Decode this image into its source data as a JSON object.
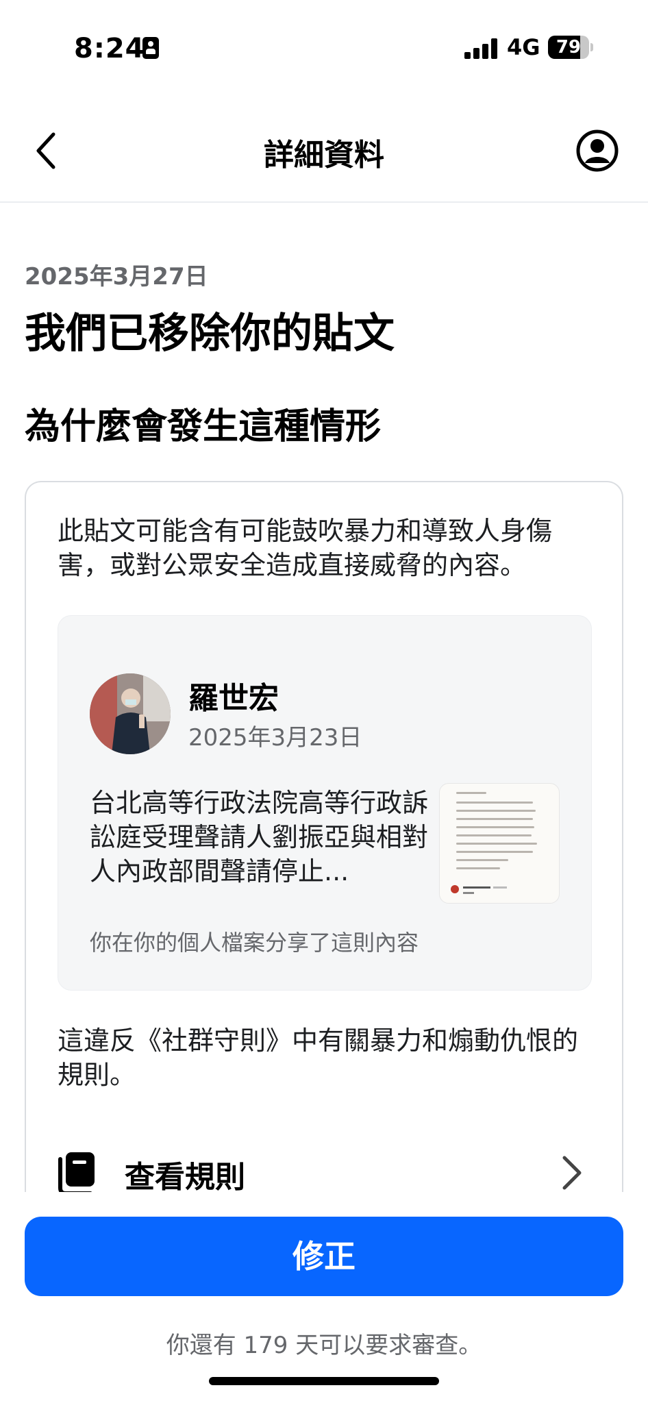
{
  "status_bar": {
    "time": "8:24",
    "network": "4G",
    "battery": "79",
    "battery_level": 0.79
  },
  "nav": {
    "title": "詳細資料",
    "back_icon": "chevron-left-icon",
    "profile_icon": "profile-circle-icon"
  },
  "notice": {
    "date": "2025年3月27日",
    "title": "我們已移除你的貼文",
    "section_title": "為什麼會發生這種情形"
  },
  "card": {
    "description": "此貼文可能含有可能鼓吹暴力和導致人身傷害，或對公眾安全造成直接威脅的內容。",
    "post": {
      "author": "羅世宏",
      "date": "2025年3月23日",
      "text": "台北高等行政法院高等行政訴訟庭受理聲請人劉振亞與相對人內政部間聲請停止...",
      "footer": "你在你的個人檔案分享了這則內容"
    },
    "violation": "這違反《社群守則》中有關暴力和煽動仇恨的規則。",
    "rules_link": "查看規則"
  },
  "actions": {
    "fix_button": "修正",
    "review_note": "你還有 179 天可以要求審查。"
  },
  "colors": {
    "primary": "#0866ff",
    "secondary_text": "#65676b",
    "card_border": "#dadde1",
    "post_bg": "#f5f6f7"
  }
}
